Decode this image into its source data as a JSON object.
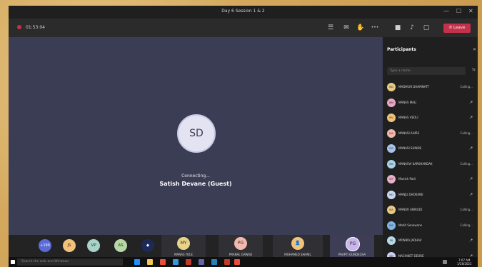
{
  "window": {
    "title": "Day 6 Session 1 & 2",
    "minimize": "—",
    "maximize": "☐",
    "close": "✕"
  },
  "toolbar": {
    "timer": "01:53:04",
    "leave_label": "Leave",
    "more": "•••"
  },
  "stage": {
    "initials": "SD",
    "status": "Connecting...",
    "name": "Satish Devane (Guest)"
  },
  "strip": {
    "small": [
      {
        "initials": "JS",
        "color": "#f0c27a"
      },
      {
        "initials": "VP",
        "color": "#a7d3c9"
      },
      {
        "initials": "AS",
        "color": "#b6d8a4"
      }
    ],
    "tiles": [
      {
        "initials": "MY",
        "name": "MANAS YOLE",
        "color": "#e8d38a"
      },
      {
        "initials": "PG",
        "name": "PRANAL GAWAD",
        "color": "#f1b8b0"
      },
      {
        "initials": "",
        "name": "MOHAMED SAHNIL",
        "color": "#f0c27a"
      },
      {
        "initials": "PG",
        "name": "PRAPTI GUNDECHA",
        "color": "#c9b6f0"
      }
    ]
  },
  "panel": {
    "title": "Participants",
    "search_placeholder": "Type a name",
    "participants": [
      {
        "initials": "MD",
        "name": "MADHURI DHAMNATT",
        "status": "Calling...",
        "color": "#e8c987"
      },
      {
        "initials": "MM",
        "name": "MANAS MALI",
        "status": "🎤",
        "color": "#e8a7c9"
      },
      {
        "initials": "MV",
        "name": "MANAS VEOLI",
        "status": "🎤",
        "color": "#f0c27a"
      },
      {
        "initials": "MA",
        "name": "MANASI AHIRE",
        "status": "Calling...",
        "color": "#f1b8b0"
      },
      {
        "initials": "MS",
        "name": "MANASI SHINDE",
        "status": "🎤",
        "color": "#a7c3e8"
      },
      {
        "initials": "MK",
        "name": "MANASVI KARKHANDAK",
        "status": "Calling...",
        "color": "#a7d3e8"
      },
      {
        "initials": "MP",
        "name": "Manish Patil",
        "status": "🎤",
        "color": "#e8b0c9"
      },
      {
        "initials": "MD",
        "name": "MANJU DHOKANE",
        "status": "🎤",
        "color": "#c9d8f0"
      },
      {
        "initials": "MA",
        "name": "MANUR ANIRUDI",
        "status": "Calling...",
        "color": "#e8c987"
      },
      {
        "initials": "MS",
        "name": "Mohit Sonawane",
        "status": "Calling...",
        "color": "#7fb4e8"
      },
      {
        "initials": "MJ",
        "name": "MONIKA JADHAV",
        "status": "🎤",
        "color": "#b6d8e8"
      },
      {
        "initials": "ND",
        "name": "NACHIKET DEORE",
        "status": "🎤",
        "color": "#c9d0f0"
      }
    ]
  },
  "taskbar": {
    "search_placeholder": "Search the web and Windows",
    "time": "7:07 AM",
    "date": "1/28/2022"
  }
}
